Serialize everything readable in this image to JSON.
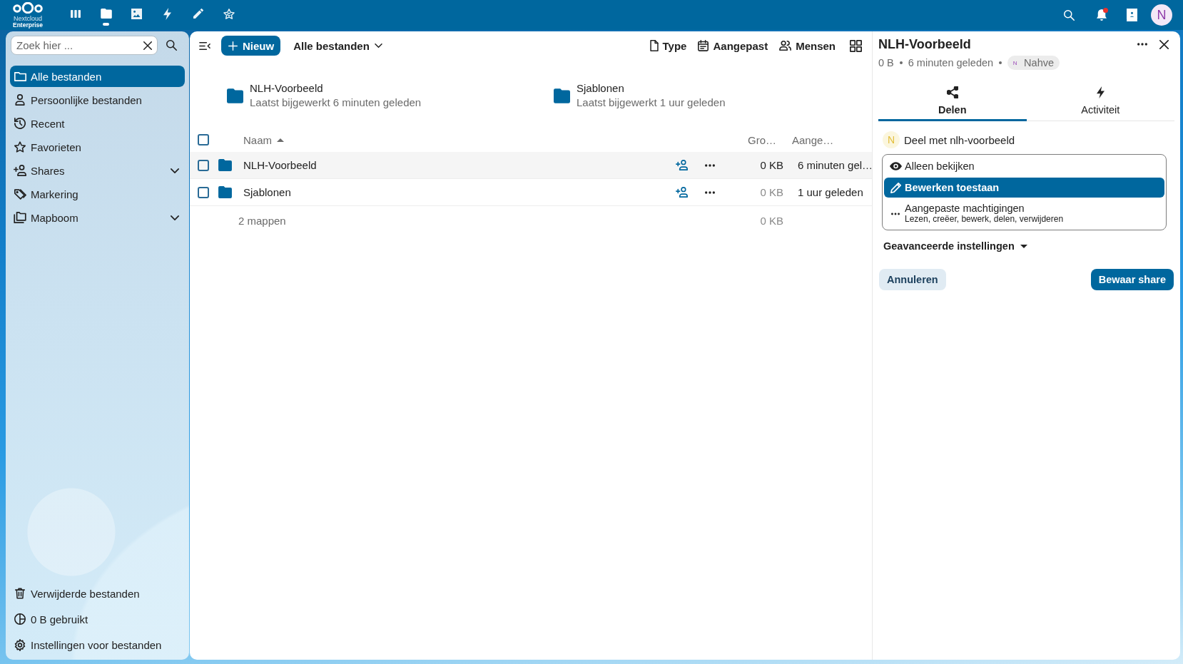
{
  "top_bar": {
    "logo": {
      "name": "Nextcloud",
      "edition": "Enterprise"
    },
    "apps": [
      {
        "kind": "dashboard",
        "selected": false
      },
      {
        "kind": "files",
        "selected": true
      },
      {
        "kind": "photos",
        "selected": false
      },
      {
        "kind": "activity",
        "selected": false
      },
      {
        "kind": "notes",
        "selected": false
      },
      {
        "kind": "collectives",
        "selected": false
      }
    ],
    "unread_notifications": true,
    "avatar": "N"
  },
  "sidebar": {
    "search": {
      "placeholder": "Zoek hier ..."
    },
    "items": [
      {
        "kind": "all",
        "label": "Alle bestanden",
        "selected": true
      },
      {
        "kind": "personal",
        "label": "Persoonlijke bestanden",
        "selected": false
      },
      {
        "kind": "recent",
        "label": "Recent",
        "selected": false
      },
      {
        "kind": "favorites",
        "label": "Favorieten",
        "selected": false
      },
      {
        "kind": "shares",
        "label": "Shares",
        "selected": false,
        "expanded": false
      },
      {
        "kind": "tags",
        "label": "Markering",
        "selected": false
      },
      {
        "kind": "folder_tree",
        "label": "Mapboom",
        "selected": false,
        "expanded": false
      }
    ],
    "footer": [
      {
        "kind": "trash",
        "label": "Verwijderde bestanden"
      },
      {
        "kind": "quota",
        "label": "0 B gebruikt"
      },
      {
        "kind": "settings",
        "label": "Instellingen voor bestanden"
      }
    ]
  },
  "files": {
    "new_button": "Nieuw",
    "breadcrumb": "Alle bestanden",
    "filters": [
      {
        "kind": "type",
        "label": "Type"
      },
      {
        "kind": "modified",
        "label": "Aangepast"
      },
      {
        "kind": "people",
        "label": "Mensen"
      }
    ],
    "recent": [
      {
        "name": "NLH-Voorbeeld",
        "subtitle": "Laatst bijgewerkt 6 minuten geleden"
      },
      {
        "name": "Sjablonen",
        "subtitle": "Laatst bijgewerkt 1 uur geleden"
      }
    ],
    "table": {
      "all_checked": false,
      "columns": [
        {
          "label": "Naam",
          "sorted": true
        },
        {
          "label": "Gro…",
          "sorted": false
        },
        {
          "label": "Aange…",
          "sorted": false
        }
      ],
      "rows": [
        {
          "name": "NLH-Voorbeeld",
          "size": "0 KB",
          "modified": "6 minuten gel…",
          "checked": false,
          "active": true
        },
        {
          "name": "Sjablonen",
          "size": "0 KB",
          "modified": "1 uur geleden",
          "checked": false,
          "active": false
        }
      ],
      "summary": {
        "count": "2 mappen",
        "size": "0 KB"
      }
    }
  },
  "details": {
    "title": "NLH-Voorbeeld",
    "size": "0 B",
    "modified": "6 minuten geleden",
    "owner": {
      "initial": "N",
      "name": "Nahve"
    },
    "tabs": [
      {
        "kind": "sharing",
        "label": "Delen",
        "selected": true
      },
      {
        "kind": "activity",
        "label": "Activiteit",
        "selected": false
      }
    ],
    "recipient": {
      "initial": "N",
      "label": "Deel met nlh-voorbeeld"
    },
    "permissions": [
      {
        "kind": "view",
        "label": "Alleen bekijken",
        "selected": false
      },
      {
        "kind": "edit",
        "label": "Bewerken toestaan",
        "selected": true
      },
      {
        "kind": "custom",
        "label": "Aangepaste machtigingen",
        "description": "Lezen, creëer, bewerk, delen, verwijderen",
        "selected": false
      }
    ],
    "advanced": {
      "label": "Geavanceerde instellingen",
      "expanded": false
    },
    "buttons": [
      {
        "kind": "secondary",
        "label": "Annuleren"
      },
      {
        "kind": "primary",
        "label": "Bewaar share"
      }
    ]
  }
}
